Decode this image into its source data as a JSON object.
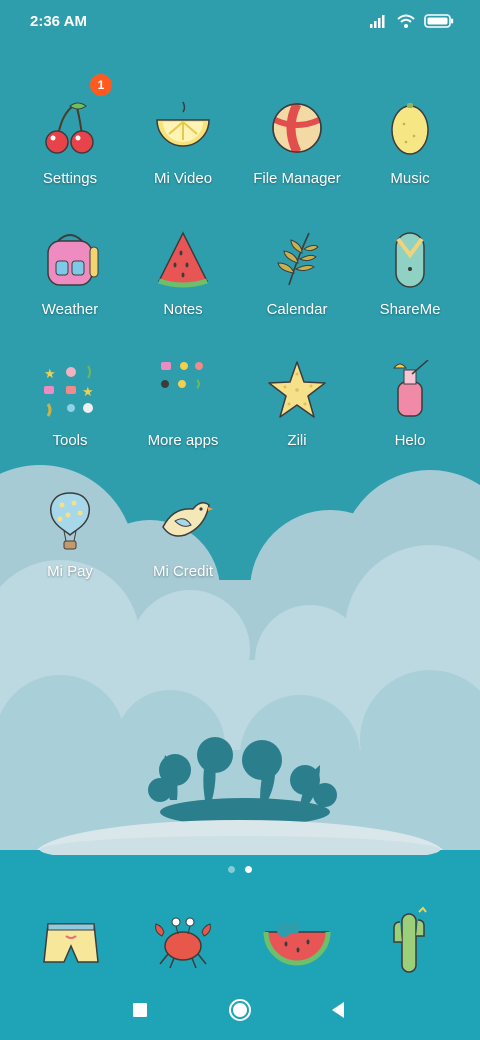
{
  "status_bar": {
    "time": "2:36 AM",
    "icons": [
      "signal-icon",
      "wifi-icon",
      "battery-icon"
    ]
  },
  "apps": [
    {
      "label": "Settings",
      "icon": "cherries-icon",
      "badge": "1"
    },
    {
      "label": "Mi Video",
      "icon": "lemon-slice-icon"
    },
    {
      "label": "File Manager",
      "icon": "beach-ball-icon"
    },
    {
      "label": "Music",
      "icon": "lemon-icon"
    },
    {
      "label": "Weather",
      "icon": "backpack-icon"
    },
    {
      "label": "Notes",
      "icon": "watermelon-slice-icon"
    },
    {
      "label": "Calendar",
      "icon": "leaf-icon"
    },
    {
      "label": "ShareMe",
      "icon": "flip-flop-icon"
    },
    {
      "label": "Tools",
      "icon": "folder-tools-icon"
    },
    {
      "label": "More apps",
      "icon": "folder-more-apps-icon"
    },
    {
      "label": "Zili",
      "icon": "starfish-icon"
    },
    {
      "label": "Helo",
      "icon": "cocktail-bottle-icon"
    },
    {
      "label": "Mi Pay",
      "icon": "hot-air-balloon-icon"
    },
    {
      "label": "Mi Credit",
      "icon": "bird-icon"
    }
  ],
  "page_indicator": {
    "pages": 2,
    "active": 2
  },
  "dock": [
    {
      "icon": "shorts-icon"
    },
    {
      "icon": "crab-icon"
    },
    {
      "icon": "bitten-watermelon-icon"
    },
    {
      "icon": "cactus-icon"
    }
  ],
  "navbar": [
    "recents-square-icon",
    "home-circle-icon",
    "back-triangle-icon"
  ],
  "colors": {
    "sky": "#2e9ead",
    "cloud_light": "#b7d6df",
    "cloud_mid": "#8fc0ce",
    "sea": "#1ea2b6",
    "badge": "#ff5a1f"
  }
}
